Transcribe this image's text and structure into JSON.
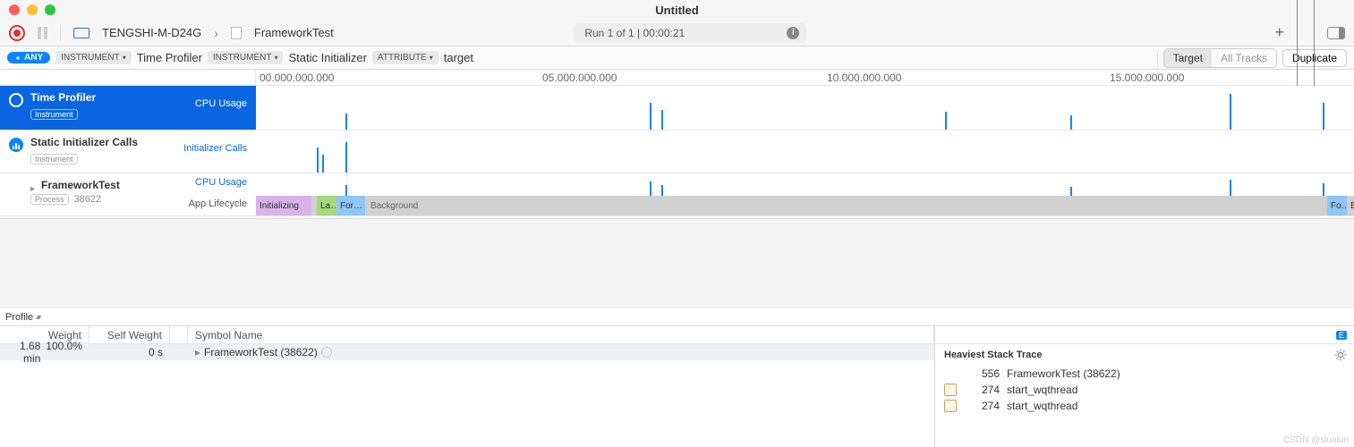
{
  "window": {
    "title": "Untitled"
  },
  "toolbar": {
    "device": "TENGSHI-M-D24G",
    "target": "FrameworkTest",
    "run_info": "Run 1 of 1  |  00:00:21"
  },
  "filter": {
    "any": "ANY",
    "instrument_label1": "INSTRUMENT",
    "time_profiler": "Time Profiler",
    "instrument_label2": "INSTRUMENT",
    "static_init": "Static Initializer",
    "attribute_label": "ATTRIBUTE",
    "target_text": "target",
    "tab_target": "Target",
    "tab_all": "All Tracks",
    "duplicate": "Duplicate"
  },
  "ruler": {
    "t0": "00.000.000.000",
    "t1": "05.000.000.000",
    "t2": "10.000.000.000",
    "t3": "15.000.000.000"
  },
  "tracks": {
    "tp": {
      "name": "Time Profiler",
      "badge": "Instrument",
      "metric": "CPU Usage"
    },
    "si": {
      "name": "Static Initializer Calls",
      "badge": "Instrument",
      "metric": "Initializer Calls"
    },
    "ft": {
      "name": "FrameworkTest",
      "badge": "Process",
      "pid": "38622",
      "metric1": "CPU Usage",
      "metric2": "App Lifecycle"
    }
  },
  "lifecycle": {
    "init": "Initializing",
    "launch": "La…",
    "fore": "For…",
    "bg": "Background",
    "fore2": "Fo…",
    "bg2": "B"
  },
  "profile": {
    "label": "Profile"
  },
  "columns": {
    "weight": "Weight",
    "self_weight": "Self Weight",
    "symbol": "Symbol Name"
  },
  "row": {
    "time": "1.68 min",
    "pct": "100.0%",
    "self": "0 s",
    "symbol": "FrameworkTest (38622)"
  },
  "hst": {
    "badge": "E",
    "title": "Heaviest Stack Trace",
    "r0": {
      "count": "556",
      "name": "FrameworkTest (38622)"
    },
    "r1": {
      "count": "274",
      "name": "start_wqthread"
    },
    "r2": {
      "count": "274",
      "name": "start_wqthread"
    }
  },
  "watermark": "CSDN @slunlun"
}
